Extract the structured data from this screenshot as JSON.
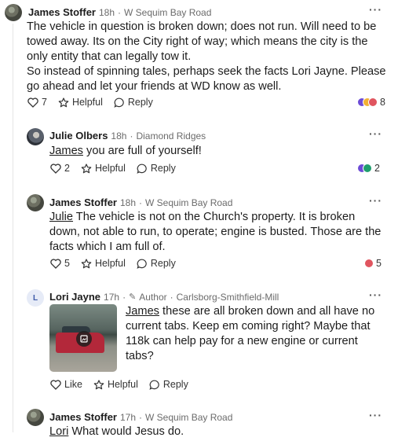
{
  "comments": [
    {
      "author": "James Stoffer",
      "time": "18h",
      "location": "W Sequim Bay Road",
      "text": "The vehicle in question is broken down; does not run. Will need to be towed away. Its on the City right of way; which means the city is the only entity that can legally tow it.",
      "text2": "So instead of spinning tales, perhaps seek the facts Lori Jayne. Please go ahead and let your friends at WD know as well.",
      "like_count": "7",
      "helpful_label": "Helpful",
      "reply_label": "Reply",
      "reaction_count": "8"
    },
    {
      "author": "Julie Olbers",
      "time": "18h",
      "location": "Diamond Ridges",
      "mention": "James",
      "text": " you are full of yourself!",
      "like_count": "2",
      "helpful_label": "Helpful",
      "reply_label": "Reply",
      "reaction_count": "2"
    },
    {
      "author": "James Stoffer",
      "time": "18h",
      "location": "W Sequim Bay Road",
      "mention": "Julie",
      "text": " The vehicle is not on the Church's property. It is broken down, not able to run, to operate; engine is busted. Those are the facts which I am full of.",
      "like_count": "5",
      "helpful_label": "Helpful",
      "reply_label": "Reply",
      "reaction_count": "5"
    },
    {
      "author": "Lori Jayne",
      "avatar_initial": "L",
      "time": "17h",
      "role": "Author",
      "location": "Carlsborg-Smithfield-Mill",
      "mention": "James",
      "text": " these are all broken down and all have no current tabs. Keep em coming right? Maybe that 118k can help pay for a new engine or current tabs?",
      "like_label": "Like",
      "helpful_label": "Helpful",
      "reply_label": "Reply"
    },
    {
      "author": "James Stoffer",
      "time": "17h",
      "location": "W Sequim Bay Road",
      "mention": "Lori",
      "text": " What would Jesus do."
    }
  ],
  "separator": "·",
  "more_icon": "more-dots-icon",
  "colors": {
    "heart_reaction": "#e0555f",
    "support_reaction": "#6c4bd6",
    "star_reaction": "#f2b134",
    "thank_reaction": "#1f9e6e"
  }
}
